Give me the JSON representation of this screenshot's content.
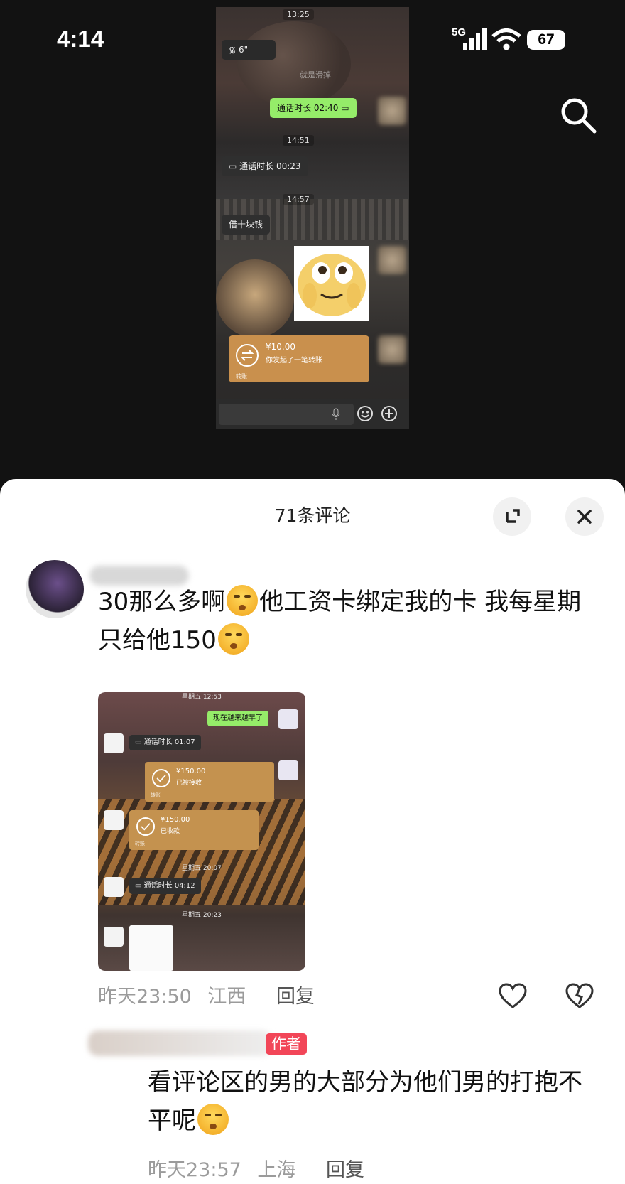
{
  "status_bar": {
    "time": "4:14",
    "network": "5G",
    "battery": "67"
  },
  "chat_screenshot": {
    "top_time": "13:25",
    "voice_message": "6\"",
    "blurred_label": "就是滑掉",
    "call_out": "通话时长 02:40",
    "time_2": "14:51",
    "call_in": "通话时长 00:23",
    "time_3": "14:57",
    "text_msg": "借十块钱",
    "transfer_amount": "¥10.00",
    "transfer_desc": "你发起了一笔转账",
    "transfer_footer": "转账"
  },
  "comments": {
    "count_title": "71条评论",
    "first": {
      "text_a": "30那么多啊",
      "text_b": "他工资卡绑定我的卡 我每星期",
      "text_c": "只给他150",
      "time": "昨天23:50",
      "location": "江西",
      "reply": "回复",
      "image": {
        "time_1": "星期五 12:53",
        "green_msg": "现在越来越早了",
        "call_1": "通话时长 01:07",
        "tr1_amount": "¥150.00",
        "tr1_status": "已被接收",
        "tr1_footer": "转账",
        "tr2_amount": "¥150.00",
        "tr2_status": "已收款",
        "tr2_footer": "转账",
        "time_2": "星期五 20:07",
        "call_2": "通话时长 04:12",
        "time_3": "星期五 20:23"
      }
    },
    "second": {
      "badge": "作者",
      "text_a": "看评论区的男的大部分为他们男的打抱不",
      "text_b": "平呢",
      "time": "昨天23:57",
      "location": "上海",
      "reply": "回复"
    }
  },
  "colors": {
    "wechat_green": "#95ec69",
    "transfer_orange": "#c9904d",
    "author_badge": "#f24658"
  },
  "icons": [
    "search-icon",
    "expand-icon",
    "close-icon",
    "like-icon",
    "dislike-icon",
    "signal-icon",
    "wifi-icon"
  ]
}
